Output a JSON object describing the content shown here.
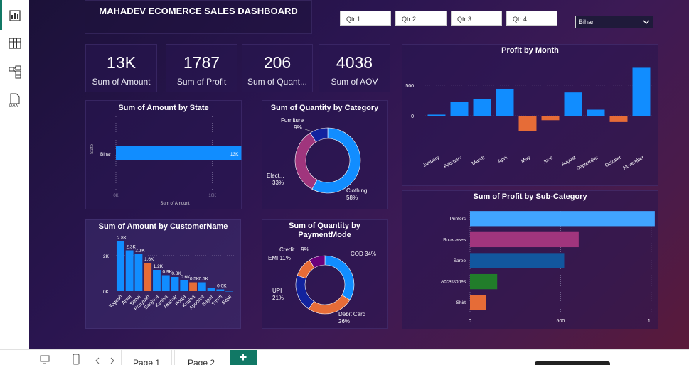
{
  "dashboard": {
    "title": "MAHADEV ECOMERCE SALES DASHBOARD"
  },
  "filters": {
    "quarters": [
      "Qtr 1",
      "Qtr 2",
      "Qtr 3",
      "Qtr 4"
    ],
    "state_selected": "Bihar"
  },
  "kpis": [
    {
      "value": "13K",
      "label": "Sum of Amount"
    },
    {
      "value": "1787",
      "label": "Sum of Profit"
    },
    {
      "value": "206",
      "label": "Sum of Quant..."
    },
    {
      "value": "4038",
      "label": "Sum of AOV"
    }
  ],
  "chart_data": [
    {
      "type": "bar",
      "orientation": "horizontal",
      "title": "Sum of Amount by State",
      "xlabel": "Sum of Amount",
      "ylabel": "State",
      "categories": [
        "Bihar"
      ],
      "values": [
        13000
      ],
      "data_labels": [
        "13K"
      ],
      "x_ticks": [
        "0K",
        "10K"
      ],
      "xlim": [
        0,
        14000
      ],
      "colors": [
        "#118dff"
      ]
    },
    {
      "type": "pie",
      "variant": "donut",
      "title": "Sum of Quantity by Category",
      "categories": [
        "Clothing",
        "Electronics",
        "Furniture"
      ],
      "values": [
        58,
        33,
        9
      ],
      "label_names": [
        "Clothing",
        "Elect...",
        "Furniture"
      ],
      "label_values": [
        "58%",
        "33%",
        "9%"
      ],
      "colors": [
        "#118dff",
        "#a0357d",
        "#12239e"
      ]
    },
    {
      "type": "bar",
      "title": "Profit by Month",
      "categories": [
        "January",
        "February",
        "March",
        "April",
        "May",
        "June",
        "August",
        "September",
        "October",
        "November"
      ],
      "values": [
        20,
        230,
        270,
        440,
        -240,
        -70,
        380,
        100,
        -100,
        780
      ],
      "y_ticks": [
        0,
        500
      ],
      "ylim": [
        -320,
        900
      ],
      "colors": {
        "positive": "#118dff",
        "negative": "#e66c37"
      }
    },
    {
      "type": "bar",
      "title": "Sum of Amount by CustomerName",
      "categories": [
        "Yogesh",
        "Amol",
        "Sonal",
        "Pratyush",
        "Sanjana",
        "Kanika",
        "Akshay",
        "Pooja",
        "Kratika",
        "Apoorva",
        "Sagar",
        "Smriti",
        "Sejal"
      ],
      "values": [
        2800,
        2300,
        2100,
        1600,
        1200,
        900,
        800,
        600,
        500,
        500,
        200,
        100,
        0
      ],
      "data_labels": [
        "2.8K",
        "2.3K",
        "2.1K",
        "1.6K",
        "1.2K",
        "0.9K",
        "0.8K",
        "0.6K",
        "0.5K",
        "0.5K",
        "",
        "0.0K",
        ""
      ],
      "highlighted": [
        3,
        8
      ],
      "y_ticks": [
        "0K",
        "2K"
      ],
      "ylim": [
        0,
        3000
      ],
      "colors": {
        "default": "#118dff",
        "highlight": "#e66c37"
      }
    },
    {
      "type": "pie",
      "variant": "donut",
      "title": "Sum of Quantity by PaymentMode",
      "categories": [
        "COD",
        "Debit Card",
        "UPI",
        "EMI",
        "Credit Card"
      ],
      "values": [
        34,
        26,
        21,
        11,
        9
      ],
      "label_names": [
        "COD",
        "Debit Card",
        "UPI",
        "EMI",
        "Credit..."
      ],
      "label_values": [
        "34%",
        "26%",
        "21%",
        "11%",
        "9%"
      ],
      "colors": [
        "#118dff",
        "#e66c37",
        "#12239e",
        "#e66c37",
        "#6b007b"
      ]
    },
    {
      "type": "bar",
      "orientation": "horizontal",
      "title": "Sum of Profit by Sub-Category",
      "categories": [
        "Printers",
        "Bookcases",
        "Saree",
        "Accessories",
        "Shirt"
      ],
      "values": [
        1020,
        600,
        520,
        150,
        90
      ],
      "x_ticks": [
        "0",
        "500",
        "1..."
      ],
      "xlim": [
        0,
        1150
      ],
      "colors": [
        "#41a4ff",
        "#a0357d",
        "#12579e",
        "#217d2a",
        "#e66c37"
      ]
    }
  ],
  "tabs": {
    "pages": [
      "Page 1",
      "Page 2"
    ],
    "add_label": "+"
  }
}
